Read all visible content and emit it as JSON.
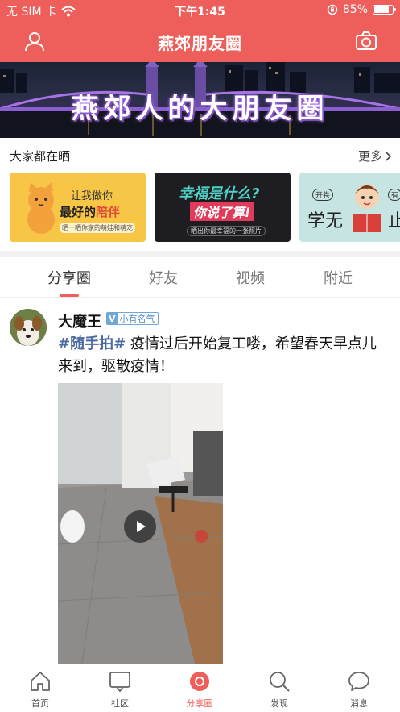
{
  "status": {
    "carrier": "无 SIM 卡",
    "time": "下午1:45",
    "battery_pct": "85%",
    "battery_level": 0.85
  },
  "header": {
    "title": "燕郊朋友圈",
    "left_icon": "user-icon",
    "right_icon": "camera-icon"
  },
  "banner": {
    "text": "燕郊人的大朋友圈"
  },
  "section": {
    "title": "大家都在晒",
    "more_label": "更多"
  },
  "cards": [
    {
      "line1": "让我做你",
      "line2": "最好的",
      "highlight": "陪伴",
      "sub": "晒一晒你家的萌娃和萌宠"
    },
    {
      "line1": "幸福是什么?",
      "line2": "你说了算!",
      "sub": "晒出你最幸福的一张照片"
    },
    {
      "left_text": "学无",
      "tag1": "开卷",
      "tag2": "有",
      "right_text": "止"
    }
  ],
  "tabs": [
    "分享圈",
    "好友",
    "视频",
    "附近"
  ],
  "active_tab": 0,
  "post": {
    "username": "大魔王",
    "badge_v": "V",
    "badge_label": "小有名气",
    "hashtag": "#随手拍#",
    "text": "疫情过后开始复工喽，希望春天早点儿来到，驱散疫情！"
  },
  "tabbar": [
    {
      "label": "首页",
      "icon": "home-icon"
    },
    {
      "label": "社区",
      "icon": "community-icon"
    },
    {
      "label": "分享圈",
      "icon": "share-circle-icon"
    },
    {
      "label": "发现",
      "icon": "discover-icon"
    },
    {
      "label": "消息",
      "icon": "message-icon"
    }
  ],
  "tabbar_active": 2,
  "colors": {
    "brand": "#ee5e5b",
    "hashtag": "#4e6aa4",
    "badge": "#6fa7d9"
  }
}
